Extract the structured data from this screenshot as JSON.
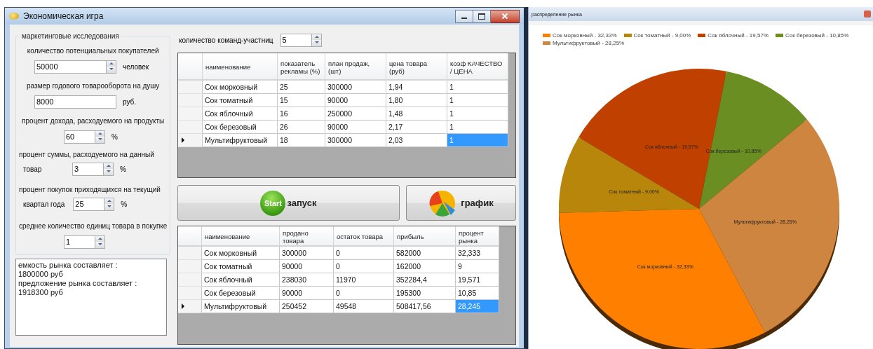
{
  "main_window": {
    "title": "Экономическая игра",
    "research": {
      "title": "маркетинговые исследования",
      "fields": [
        {
          "kind": "wide_spin",
          "label": "количество потенциальных покупателей",
          "value": "50000",
          "unit": "человек"
        },
        {
          "kind": "text",
          "label": "размер годового товарооборота на душу",
          "value": "8000",
          "unit": "руб."
        },
        {
          "kind": "spin",
          "label": "процент дохода, расходуемого на продукты",
          "value": "60",
          "unit": "%"
        },
        {
          "kind": "spin",
          "label": "процент суммы, расходуемого на данный",
          "prefix": "товар",
          "value": "3",
          "unit": "%"
        },
        {
          "kind": "spin",
          "label": "процент покупок приходящихся на текущий",
          "prefix": "квартал года",
          "value": "25",
          "unit": "%"
        },
        {
          "kind": "spin",
          "label": "среднее количество единиц товара в покупке",
          "value": "1"
        }
      ]
    },
    "output": [
      "емкость рынка составляет :",
      "1800000 руб",
      "предложение рынка составляет :",
      "1918300 руб"
    ],
    "teams": {
      "label": "количество команд-участниц",
      "value": "5"
    },
    "input_table": {
      "columns": [
        "наименование",
        "показатель рекламы (%)",
        "план продаж, (шт)",
        "цена товара (руб)",
        "коэф КАЧЕСТВО / ЦЕНА"
      ],
      "rows": [
        {
          "cells": [
            "Сок морковный",
            "25",
            "300000",
            "1,94",
            "1"
          ],
          "current": false,
          "selected": false
        },
        {
          "cells": [
            "Сок томатный",
            "15",
            "90000",
            "1,80",
            "1"
          ],
          "current": false,
          "selected": false
        },
        {
          "cells": [
            "Сок яблочный",
            "16",
            "250000",
            "1,48",
            "1"
          ],
          "current": false,
          "selected": false
        },
        {
          "cells": [
            "Сок березовый",
            "26",
            "90000",
            "2,17",
            "1"
          ],
          "current": false,
          "selected": false
        },
        {
          "cells": [
            "Мультифруктовый",
            "18",
            "300000",
            "2,03",
            "1"
          ],
          "current": true,
          "selected": true
        }
      ]
    },
    "buttons": [
      {
        "kind": "start",
        "badge": "Start",
        "label": "запуск"
      },
      {
        "kind": "chart",
        "label": "график"
      }
    ],
    "result_table": {
      "columns": [
        "наименование",
        "продано товара",
        "остаток товара",
        "прибыль",
        "процент рынка"
      ],
      "rows": [
        {
          "cells": [
            "Сок морковный",
            "300000",
            "0",
            "582000",
            "32,333"
          ],
          "current": false,
          "selected": false
        },
        {
          "cells": [
            "Сок томатный",
            "90000",
            "0",
            "162000",
            "9"
          ],
          "current": false,
          "selected": false
        },
        {
          "cells": [
            "Сок яблочный",
            "238030",
            "11970",
            "352284,4",
            "19,571"
          ],
          "current": false,
          "selected": false
        },
        {
          "cells": [
            "Сок березовый",
            "90000",
            "0",
            "195300",
            "10,85"
          ],
          "current": false,
          "selected": false
        },
        {
          "cells": [
            "Мультифруктовый",
            "250452",
            "49548",
            "508417,56",
            "28,245"
          ],
          "current": true,
          "selected": true
        }
      ]
    }
  },
  "chart_window": {
    "title": "распределение рынка",
    "legend": [
      {
        "label": "Сок морковный - 32,33%",
        "color": "#ff8000"
      },
      {
        "label": "Сок томатный - 9,00%",
        "color": "#b8860b"
      },
      {
        "label": "Сок яблочный - 19,57%",
        "color": "#c04000"
      },
      {
        "label": "Сок березовый - 10,85%",
        "color": "#6b8e23"
      },
      {
        "label": "Мультифруктовый - 28,25%",
        "color": "#cd853f"
      }
    ],
    "chart_data": {
      "type": "pie",
      "values": [
        32.33,
        9.0,
        19.57,
        10.85,
        28.25
      ],
      "annotations": [
        "Сок морковный - 32,33%",
        "Сок томатный - 9,00%",
        "Сок яблочный - 19,57%",
        "Сок березовый - 10,85%",
        "Мультифруктовый - 28,25%"
      ]
    }
  }
}
